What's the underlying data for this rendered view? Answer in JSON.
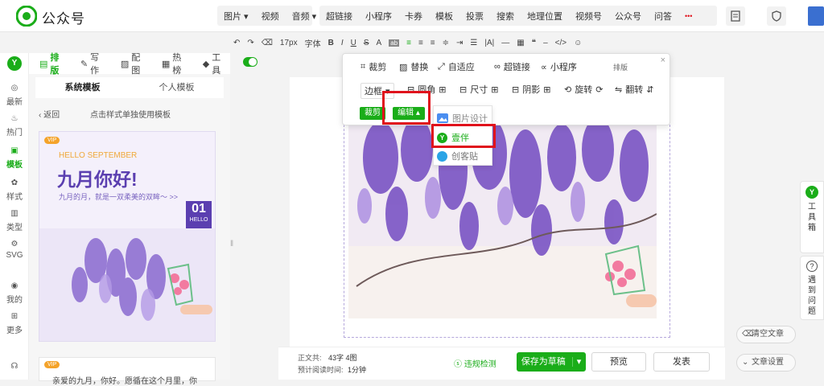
{
  "header": {
    "title": "公众号",
    "menu_group_1": [
      "图片 ▾",
      "视频",
      "音频 ▾"
    ],
    "menu_group_2": [
      "超链接",
      "小程序",
      "卡券",
      "模板",
      "投票",
      "搜索",
      "地理位置",
      "视频号",
      "公众号",
      "问答"
    ],
    "more": "•••"
  },
  "toolbar": {
    "font_size": "17px",
    "font_label": "字体",
    "items": [
      "B",
      "I",
      "U",
      "S",
      "A"
    ]
  },
  "leftnav": {
    "items": [
      "最新",
      "热门",
      "模板",
      "样式",
      "类型",
      "SVG",
      "我的",
      "更多"
    ]
  },
  "panel": {
    "tabs": [
      "排版",
      "写作",
      "配图",
      "热榜",
      "工具"
    ],
    "subtabs": [
      "系统模板",
      "个人模板"
    ],
    "back": "返回",
    "hint": "点击样式单独使用模板",
    "card": {
      "vip": "VIP",
      "hello": "HELLO SEPTEMBER",
      "title": "九月你好!",
      "subtitle": "九月的月，就是一双柔美的双眸～ >>",
      "day": "01",
      "day_sub": "HELLO"
    },
    "card2_vip": "VIP",
    "card2_text": "亲爱的九月，你好。愿循在这个月里，你"
  },
  "popup": {
    "crop": "裁剪",
    "replace": "替换",
    "auto_fit": "自适应",
    "hyperlink": "超链接",
    "miniprogram": "小程序",
    "border": "边框",
    "radius": "圆角",
    "size": "尺寸",
    "shadow": "阴影",
    "rotate": "旋转",
    "flip": "翻转",
    "crop_btn": "裁剪",
    "edit_btn": "编辑 ▴",
    "partial_label": "排版"
  },
  "dropdown": {
    "items": [
      "图片设计",
      "壹伴",
      "创客贴"
    ]
  },
  "bottombar": {
    "word_count_label": "正文共:",
    "word_count_value": "43字 4图",
    "read_time_label": "预计阅读时间:",
    "read_time_value": "1分钟",
    "check": "违规检测",
    "save_draft": "保存为草稿",
    "preview": "预览",
    "publish": "发表"
  },
  "right": {
    "toolbox": "工具箱",
    "help": "遇到问题",
    "clear": "清空文章",
    "settings": "文章设置"
  },
  "colors": {
    "accent": "#1aad19",
    "highlight": "#e0121c",
    "purple": "#6a4cc2"
  }
}
